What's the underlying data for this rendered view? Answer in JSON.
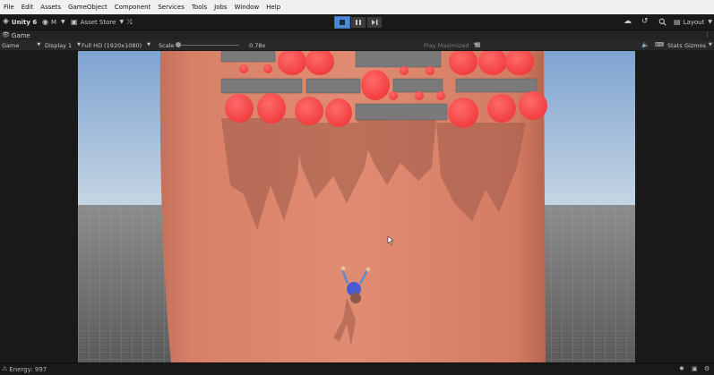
{
  "menu": [
    "File",
    "Edit",
    "Assets",
    "GameObject",
    "Component",
    "Services",
    "Tools",
    "Jobs",
    "Window",
    "Help"
  ],
  "toolbar": {
    "app_label": "Unity 6",
    "account_label": "M",
    "asset_store_label": "Asset Store",
    "layout_label": "Layout"
  },
  "tab": {
    "label": "Game"
  },
  "gamebar": {
    "view_mode": "Game",
    "display": "Display 1",
    "resolution": "Full HD (1920x1080)",
    "scale_label": "Scale",
    "scale_value": "0.78x",
    "play_mode": "Play Maximized",
    "stats": "Stats",
    "gizmos": "Gizmos"
  },
  "status": {
    "energy": "Energy: 997"
  },
  "colors": {
    "menubar": "#f0f0f0",
    "toolbar": "#191919",
    "accent_play": "#4a8ad8",
    "sky": "#9bbce0",
    "pillar": "#d87f66",
    "ball": "#ff4a4a"
  }
}
